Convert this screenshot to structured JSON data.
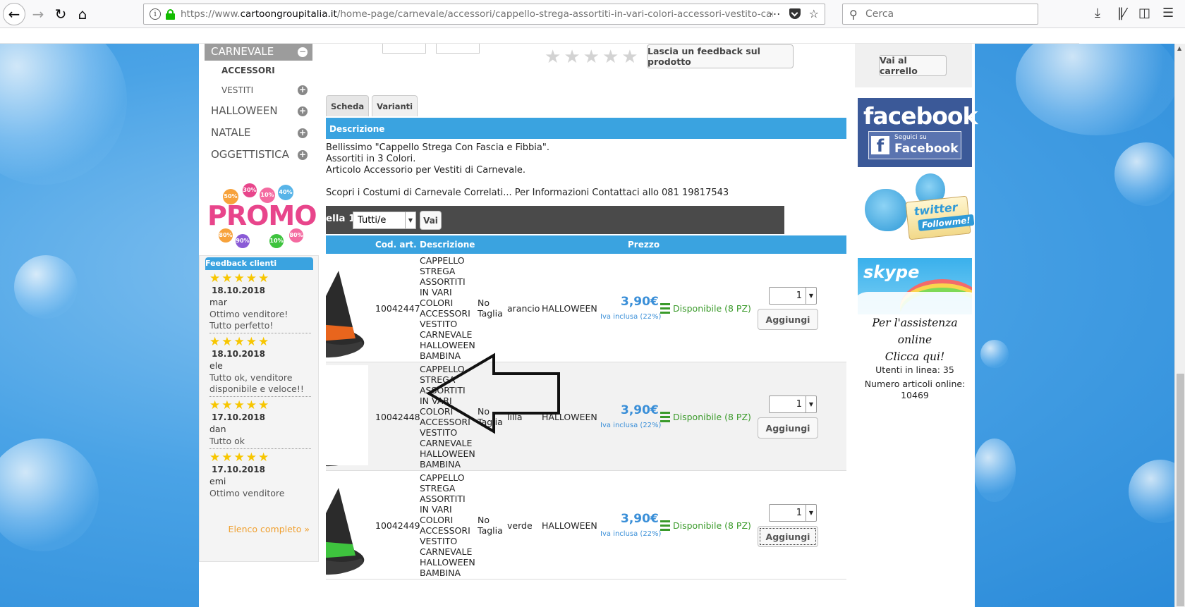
{
  "browser": {
    "url_prefix": "https://www.",
    "url_host": "cartoongroupitalia.it",
    "url_path": "/home-page/carnevale/accessori/cappello-strega-assortiti-in-vari-colori-accessori-vestito-carnevale-",
    "search_placeholder": "Cerca",
    "more_icon": "⋯",
    "bookmark_icon": "☆"
  },
  "menu": {
    "active_category": "CARNEVALE",
    "subcategories": [
      "ACCESSORI",
      "VESTITI"
    ],
    "categories": [
      "HALLOWEEN",
      "NATALE",
      "OGGETTISTICA"
    ]
  },
  "promo": {
    "word": "PROMO",
    "badges": [
      "50%",
      "30%",
      "10%",
      "40%",
      "80%",
      "90%",
      "10%",
      "80%"
    ]
  },
  "feedback": {
    "title": "Feedback clienti",
    "entries": [
      {
        "date": "18.10.2018",
        "user": "mar",
        "text": "Ottimo venditore! Tutto perfetto!",
        "stars": 5
      },
      {
        "date": "18.10.2018",
        "user": "ele",
        "text": "Tutto ok, venditore disponibile e veloce!!",
        "stars": 5
      },
      {
        "date": "17.10.2018",
        "user": "dan",
        "text": "Tutto ok",
        "stars": 5
      },
      {
        "date": "17.10.2018",
        "user": "emi",
        "text": "Ottimo venditore",
        "stars": 5
      }
    ],
    "more_link": "Elenco completo »"
  },
  "product": {
    "feedback_button": "Lascia un feedback sul prodotto",
    "tabs": [
      "Scheda",
      "Varianti"
    ],
    "description_header": "Descrizione",
    "description_lines": [
      "Bellissimo \"Cappello Strega Con Fascia e Fibbia\".",
      "Assortiti in 3 Colori.",
      "Articolo Accessorio per Vestiti di Carnevale.",
      "",
      "Scopri i Costumi di Carnevale Correlati... Per Informazioni Contattaci allo 081 19817543"
    ]
  },
  "pager": {
    "label": "ella 1",
    "select_value": "Tutti/e",
    "go_label": "Vai"
  },
  "table": {
    "headers": {
      "code": "Cod. art.",
      "desc": "Descrizione",
      "price": "Prezzo"
    },
    "rows": [
      {
        "code": "10042447",
        "desc": "CAPPELLO STREGA ASSORTITI IN VARI COLORI ACCESSORI VESTITO CARNEVALE HALLOWEEN BAMBINA",
        "size": "No Taglia",
        "color": "arancio",
        "cat": "HALLOWEEN",
        "price": "3,90€",
        "iva": "Iva inclusa (22%)",
        "avail": "Disponibile (8 PZ)",
        "qty": "1",
        "add": "Aggiungi",
        "band": "#e8651d"
      },
      {
        "code": "10042448",
        "desc": "CAPPELLO STREGA ASSORTITI IN VARI COLORI ACCESSORI VESTITO CARNEVALE HALLOWEEN BAMBINA",
        "size": "No Taglia",
        "color": "lilla",
        "cat": "HALLOWEEN",
        "price": "3,90€",
        "iva": "Iva inclusa (22%)",
        "avail": "Disponibile (8 PZ)",
        "qty": "1",
        "add": "Aggiungi",
        "band": "#9a63d6"
      },
      {
        "code": "10042449",
        "desc": "CAPPELLO STREGA ASSORTITI IN VARI COLORI ACCESSORI VESTITO CARNEVALE HALLOWEEN BAMBINA",
        "size": "No Taglia",
        "color": "verde",
        "cat": "HALLOWEEN",
        "price": "3,90€",
        "iva": "Iva inclusa (22%)",
        "avail": "Disponibile (8 PZ)",
        "qty": "1",
        "add": "Aggiungi",
        "band": "#3ec33e"
      }
    ]
  },
  "right": {
    "cart_button": "Vai al carrello",
    "facebook_logo": "facebook",
    "facebook_sub1": "Seguici su",
    "facebook_sub2": "Facebook",
    "twitter_word": "twitter",
    "twitter_follow": "Followme!",
    "skype_logo": "skype",
    "assist_line1": "Per l'assistenza online",
    "assist_line2": "Clicca qui!",
    "users_online": "Utenti in linea: 35",
    "articles_online": "Numero articoli online: 10469"
  },
  "colors": {
    "accent_blue": "#3aa3e0",
    "price_blue": "#3a8fd8",
    "available_green": "#3a9a2a",
    "star_yellow": "#f7c600"
  }
}
